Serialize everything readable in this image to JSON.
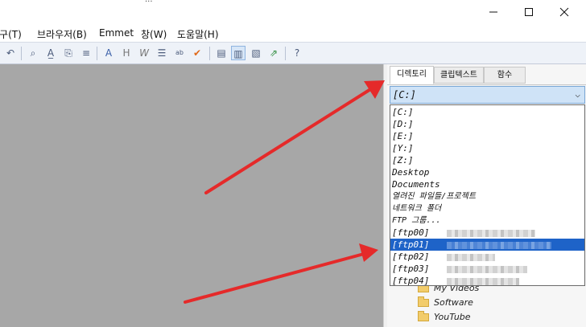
{
  "window": {
    "title_fragment": "...",
    "minimize_glyph": "—",
    "maximize_glyph": "☐",
    "close_glyph": "✕"
  },
  "menu": {
    "items": [
      "도구(T)",
      "브라우저(B)",
      "Emmet",
      "창(W)",
      "도움말(H)"
    ]
  },
  "toolbar": {
    "icons": [
      "undo-icon",
      "find-icon",
      "replace-icon",
      "clip-icon",
      "format-icon",
      "font-icon",
      "heading-icon",
      "italic-w-icon",
      "list-icon",
      "abc-list-icon",
      "spellcheck-icon",
      "sidebar-icon",
      "panel-icon",
      "doc-icon",
      "export-icon",
      "help-pointer-icon"
    ]
  },
  "panel": {
    "tabs": [
      "디렉토리",
      "클립텍스트",
      "함수"
    ],
    "active_tab": 0,
    "combo_value": "[C:]",
    "chevron": "⌵",
    "drive_options": [
      {
        "label": "[C:]"
      },
      {
        "label": "[D:]"
      },
      {
        "label": "[E:]"
      },
      {
        "label": "[Y:]"
      },
      {
        "label": "[Z:]"
      },
      {
        "label": "Desktop"
      },
      {
        "label": "Documents"
      },
      {
        "label": "열려진 파일들/프로젝트"
      },
      {
        "label": "네트워크 폴더"
      },
      {
        "label": "FTP 그룹..."
      },
      {
        "label": "[ftp00]",
        "blurred": true
      },
      {
        "label": "[ftp01]",
        "blurred": true,
        "selected": true
      },
      {
        "label": "[ftp02]",
        "blurred": true
      },
      {
        "label": "[ftp03]",
        "blurred": true
      },
      {
        "label": "[ftp04]",
        "blurred": true
      }
    ],
    "folders": [
      "My Videos",
      "Software",
      "YouTube"
    ]
  },
  "annotation_color": "#e52a2a"
}
